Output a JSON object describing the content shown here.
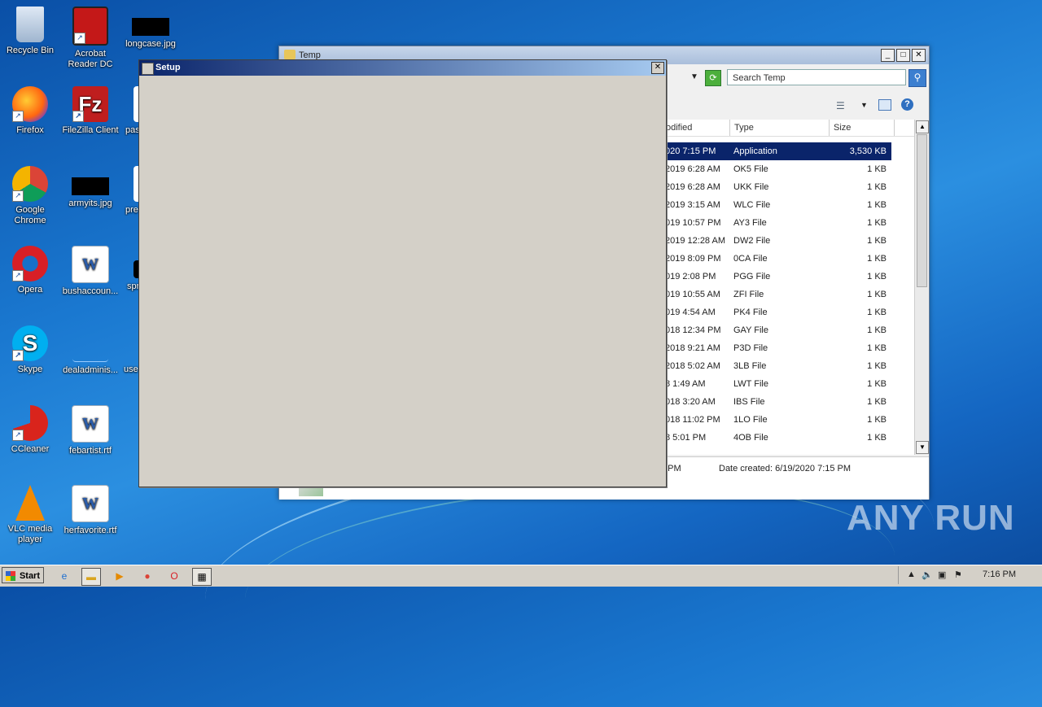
{
  "desktop": {
    "icons": [
      {
        "label": "Recycle Bin",
        "icon": "recycle-bin-icon"
      },
      {
        "label": "Acrobat\nReader DC",
        "icon": "acrobat-icon"
      },
      {
        "label": "longcase.jpg",
        "icon": "image-thumb-icon"
      },
      {
        "label": "Firefox",
        "icon": "firefox-icon"
      },
      {
        "label": "FileZilla Client",
        "icon": "filezilla-icon"
      },
      {
        "label": "pas",
        "icon": "file-icon"
      },
      {
        "label": "Google\nChrome",
        "icon": "chrome-icon"
      },
      {
        "label": "armyits.jpg",
        "icon": "image-thumb-icon"
      },
      {
        "label": "pre",
        "icon": "file-icon"
      },
      {
        "label": "Opera",
        "icon": "opera-icon"
      },
      {
        "label": "bushaccoun...",
        "icon": "word-doc-icon"
      },
      {
        "label": "spr",
        "icon": "file-icon"
      },
      {
        "label": "Skype",
        "icon": "skype-icon"
      },
      {
        "label": "dealadminis...",
        "icon": "file-icon"
      },
      {
        "label": "use",
        "icon": "file-icon"
      },
      {
        "label": "CCleaner",
        "icon": "ccleaner-icon"
      },
      {
        "label": "febartist.rtf",
        "icon": "word-doc-icon"
      },
      {
        "label": "VLC media\nplayer",
        "icon": "vlc-icon"
      },
      {
        "label": "herfavorite.rtf",
        "icon": "word-doc-icon"
      }
    ]
  },
  "explorer": {
    "title": "Temp",
    "search_placeholder": "Search Temp",
    "columns": [
      "odified",
      "Type",
      "Size"
    ],
    "rows": [
      {
        "modified": "020 7:15 PM",
        "type": "Application",
        "size": "3,530 KB",
        "selected": true
      },
      {
        "modified": "2019 6:28 AM",
        "type": "OK5 File",
        "size": "1 KB"
      },
      {
        "modified": "2019 6:28 AM",
        "type": "UKK File",
        "size": "1 KB"
      },
      {
        "modified": "2019 3:15 AM",
        "type": "WLC File",
        "size": "1 KB"
      },
      {
        "modified": "019 10:57 PM",
        "type": "AY3 File",
        "size": "1 KB"
      },
      {
        "modified": "2019 12:28 AM",
        "type": "DW2 File",
        "size": "1 KB"
      },
      {
        "modified": "2019 8:09 PM",
        "type": "0CA File",
        "size": "1 KB"
      },
      {
        "modified": "019 2:08 PM",
        "type": "PGG File",
        "size": "1 KB"
      },
      {
        "modified": "019 10:55 AM",
        "type": "ZFI File",
        "size": "1 KB"
      },
      {
        "modified": "019 4:54 AM",
        "type": "PK4 File",
        "size": "1 KB"
      },
      {
        "modified": "018 12:34 PM",
        "type": "GAY File",
        "size": "1 KB"
      },
      {
        "modified": "2018 9:21 AM",
        "type": "P3D File",
        "size": "1 KB"
      },
      {
        "modified": "2018 5:02 AM",
        "type": "3LB File",
        "size": "1 KB"
      },
      {
        "modified": "8 1:49 AM",
        "type": "LWT File",
        "size": "1 KB"
      },
      {
        "modified": "018 3:20 AM",
        "type": "IBS File",
        "size": "1 KB"
      },
      {
        "modified": "018 11:02 PM",
        "type": "1LO File",
        "size": "1 KB"
      },
      {
        "modified": "8 5:01 PM",
        "type": "4OB File",
        "size": "1 KB"
      }
    ],
    "details": {
      "time": "5 PM",
      "date_created": "Date created: 6/19/2020 7:15 PM"
    }
  },
  "setup": {
    "title": "Setup"
  },
  "taskbar": {
    "start_label": "Start",
    "clock": "7:16 PM"
  },
  "watermark": "ANY RUN"
}
